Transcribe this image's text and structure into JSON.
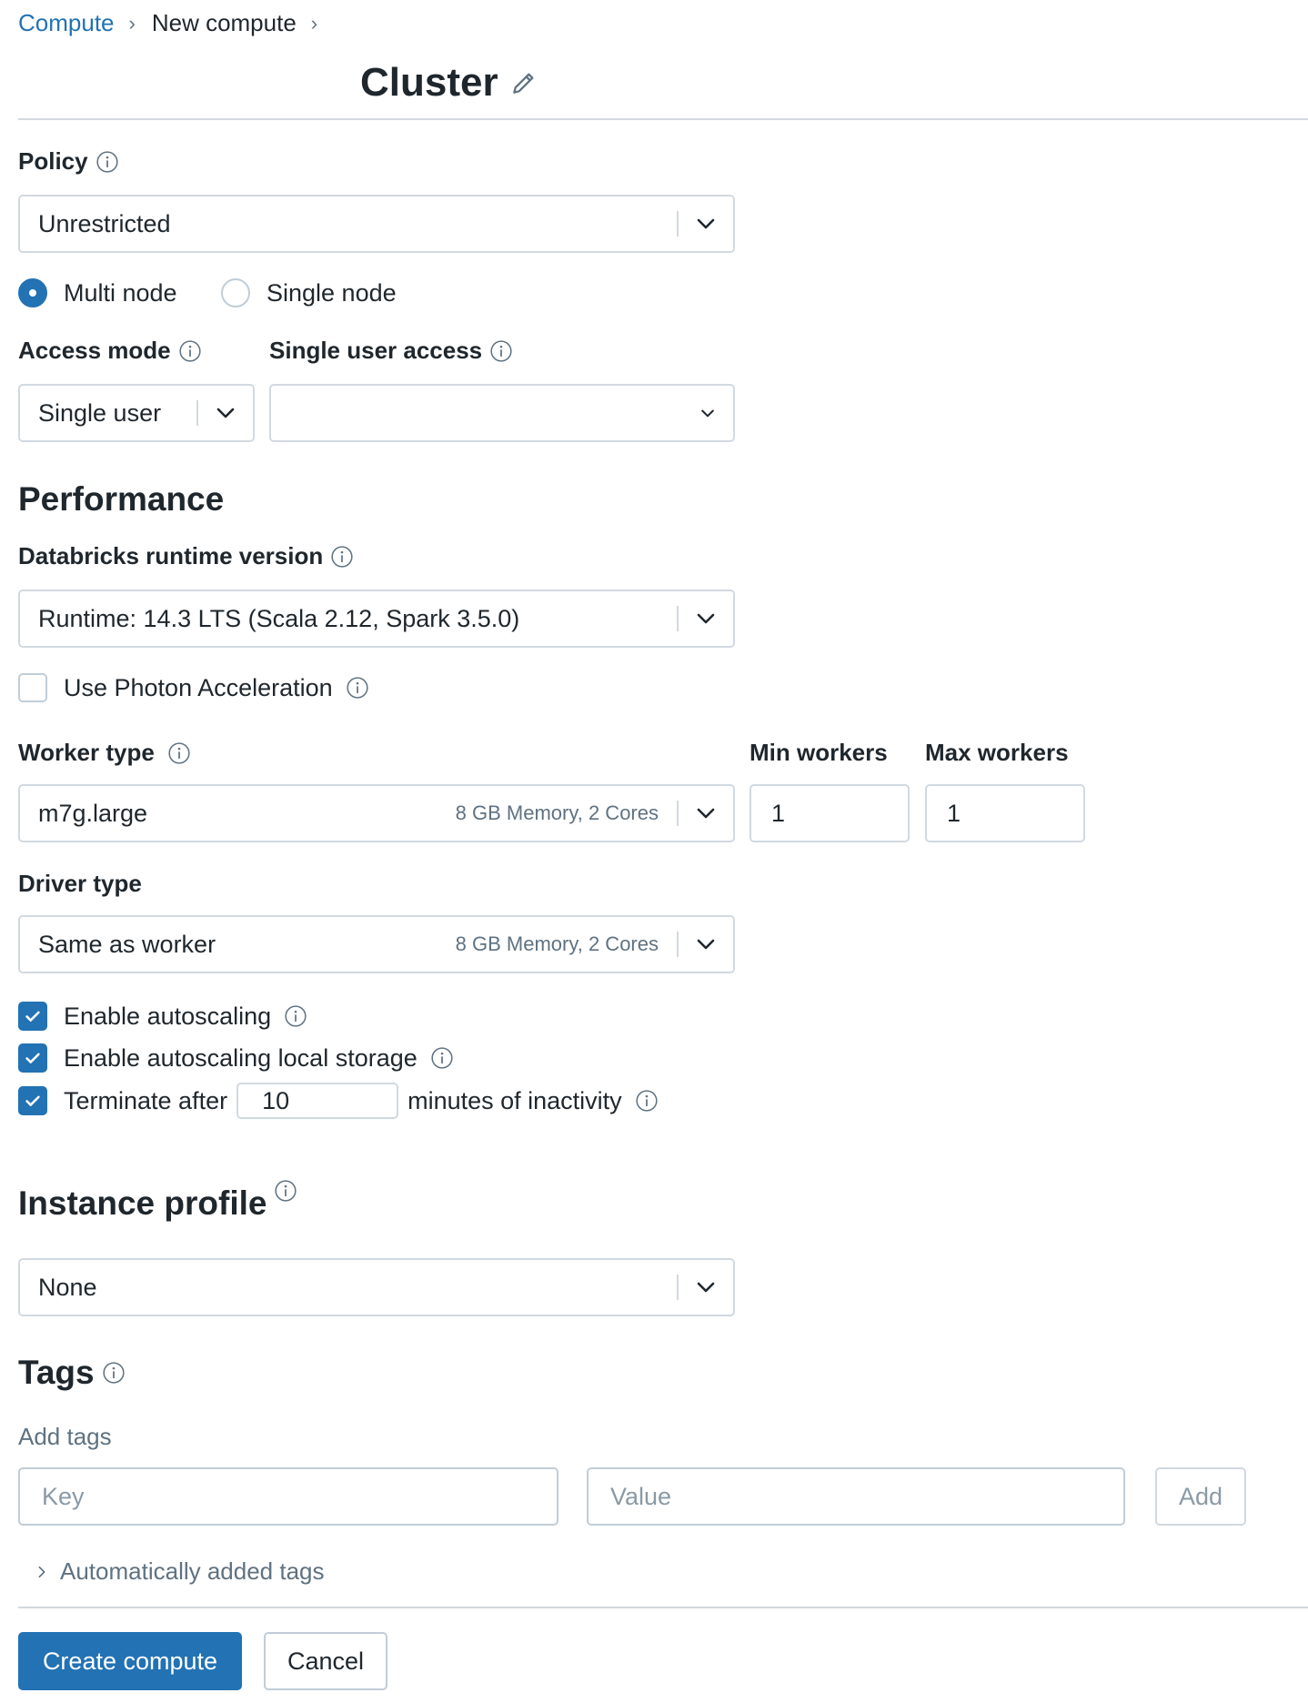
{
  "breadcrumb": {
    "compute": "Compute",
    "new_compute": "New compute",
    "sep": "›"
  },
  "page_title": "Cluster",
  "policy": {
    "label": "Policy",
    "value": "Unrestricted"
  },
  "node_mode": {
    "options": [
      "Multi node",
      "Single node"
    ],
    "selected": "Multi node"
  },
  "access_mode": {
    "label": "Access mode",
    "value": "Single user"
  },
  "single_user_access": {
    "label": "Single user access",
    "value": ""
  },
  "performance": {
    "heading": "Performance",
    "runtime_label": "Databricks runtime version",
    "runtime_value": "Runtime: 14.3 LTS (Scala 2.12, Spark 3.5.0)",
    "photon_label": "Use Photon Acceleration",
    "photon_checked": false
  },
  "worker": {
    "label": "Worker type",
    "value": "m7g.large",
    "spec": "8 GB Memory, 2 Cores",
    "min_label": "Min workers",
    "min_value": "1",
    "max_label": "Max workers",
    "max_value": "1"
  },
  "driver": {
    "label": "Driver type",
    "value": "Same as worker",
    "spec": "8 GB Memory, 2 Cores"
  },
  "options": {
    "autoscaling": {
      "label": "Enable autoscaling",
      "checked": true
    },
    "autoscaling_storage": {
      "label": "Enable autoscaling local storage",
      "checked": true
    },
    "terminate": {
      "label_before": "Terminate after",
      "minutes": "10",
      "label_after": "minutes of inactivity",
      "checked": true
    }
  },
  "instance_profile": {
    "heading": "Instance profile",
    "value": "None"
  },
  "tags": {
    "heading": "Tags",
    "add_label": "Add tags",
    "key_placeholder": "Key",
    "value_placeholder": "Value",
    "add_button": "Add",
    "auto_tags": "Automatically added tags"
  },
  "footer": {
    "create": "Create compute",
    "cancel": "Cancel"
  },
  "colors": {
    "accent": "#2272b4",
    "border": "#d1d9e1",
    "text": "#1f272d",
    "muted": "#5f7281"
  }
}
